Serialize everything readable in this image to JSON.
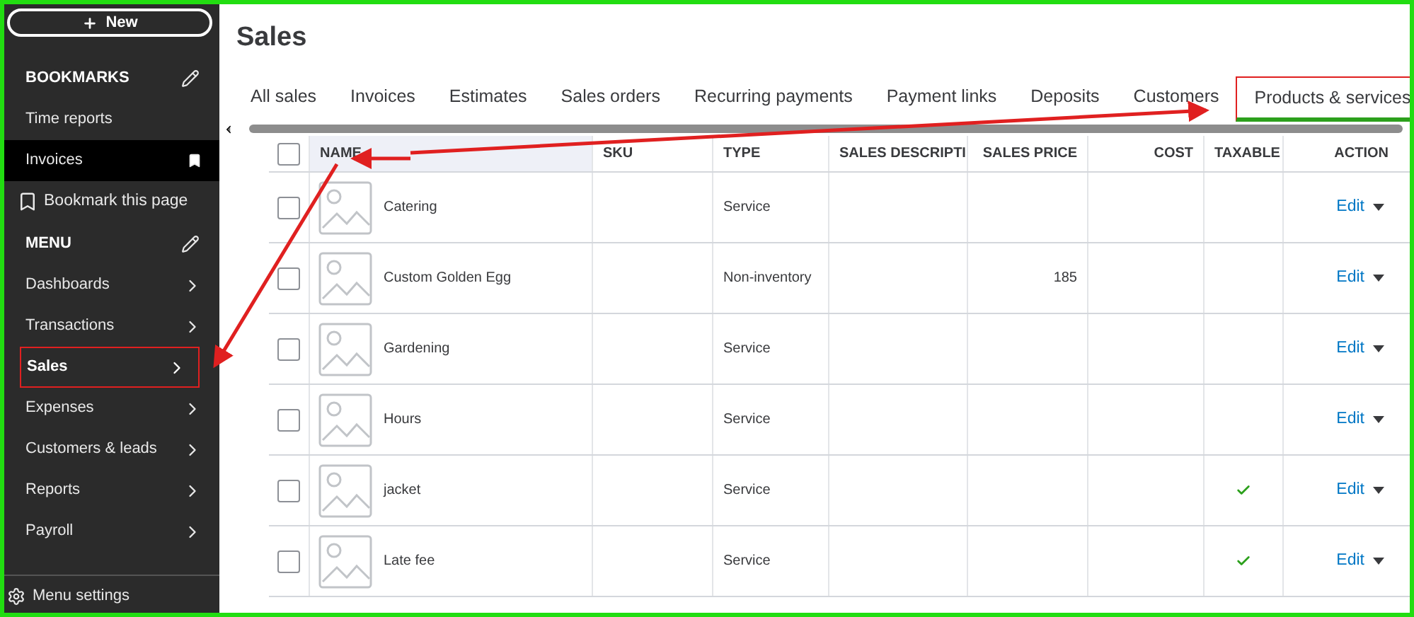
{
  "sidebar": {
    "new_button": "New",
    "sections": [
      {
        "title": "BOOKMARKS",
        "items": [
          {
            "label": "Time reports",
            "kind": "link",
            "selected": false
          },
          {
            "label": "Invoices",
            "kind": "bookmarked",
            "selected": true
          },
          {
            "label": "Bookmark this page",
            "kind": "action",
            "selected": false
          }
        ]
      },
      {
        "title": "MENU",
        "items": [
          {
            "label": "Dashboards",
            "kind": "menu",
            "selected": false,
            "highlighted": false
          },
          {
            "label": "Transactions",
            "kind": "menu",
            "selected": false,
            "highlighted": false
          },
          {
            "label": "Sales",
            "kind": "menu",
            "selected": true,
            "highlighted": true
          },
          {
            "label": "Expenses",
            "kind": "menu",
            "selected": false,
            "highlighted": false
          },
          {
            "label": "Customers & leads",
            "kind": "menu",
            "selected": false,
            "highlighted": false
          },
          {
            "label": "Reports",
            "kind": "menu",
            "selected": false,
            "highlighted": false
          },
          {
            "label": "Payroll",
            "kind": "menu",
            "selected": false,
            "highlighted": false
          }
        ]
      }
    ],
    "footer": "Menu settings"
  },
  "page": {
    "title": "Sales"
  },
  "tabs": [
    {
      "label": "All sales",
      "selected": false,
      "highlighted": false
    },
    {
      "label": "Invoices",
      "selected": false,
      "highlighted": false
    },
    {
      "label": "Estimates",
      "selected": false,
      "highlighted": false
    },
    {
      "label": "Sales orders",
      "selected": false,
      "highlighted": false
    },
    {
      "label": "Recurring payments",
      "selected": false,
      "highlighted": false
    },
    {
      "label": "Payment links",
      "selected": false,
      "highlighted": false
    },
    {
      "label": "Deposits",
      "selected": false,
      "highlighted": false
    },
    {
      "label": "Customers",
      "selected": false,
      "highlighted": false
    },
    {
      "label": "Products & services",
      "selected": true,
      "highlighted": true
    }
  ],
  "table": {
    "select_all_checked": false,
    "columns": [
      "NAME",
      "SKU",
      "TYPE",
      "SALES DESCRIPTI",
      "SALES PRICE",
      "COST",
      "TAXABLE",
      "ACTION"
    ],
    "rows": [
      {
        "checked": false,
        "name": "Catering",
        "type": "Service",
        "taxable": false,
        "action": "Edit"
      },
      {
        "checked": false,
        "name": "Custom Golden Egg",
        "type": "Non-inventory",
        "price": "185",
        "taxable": false,
        "action": "Edit"
      },
      {
        "checked": false,
        "name": "Gardening",
        "type": "Service",
        "taxable": false,
        "action": "Edit"
      },
      {
        "checked": false,
        "name": "Hours",
        "type": "Service",
        "taxable": false,
        "action": "Edit"
      },
      {
        "checked": false,
        "name": "jacket",
        "type": "Service",
        "taxable": true,
        "action": "Edit"
      },
      {
        "checked": false,
        "name": "Late fee",
        "type": "Service",
        "taxable": true,
        "action": "Edit"
      }
    ]
  }
}
